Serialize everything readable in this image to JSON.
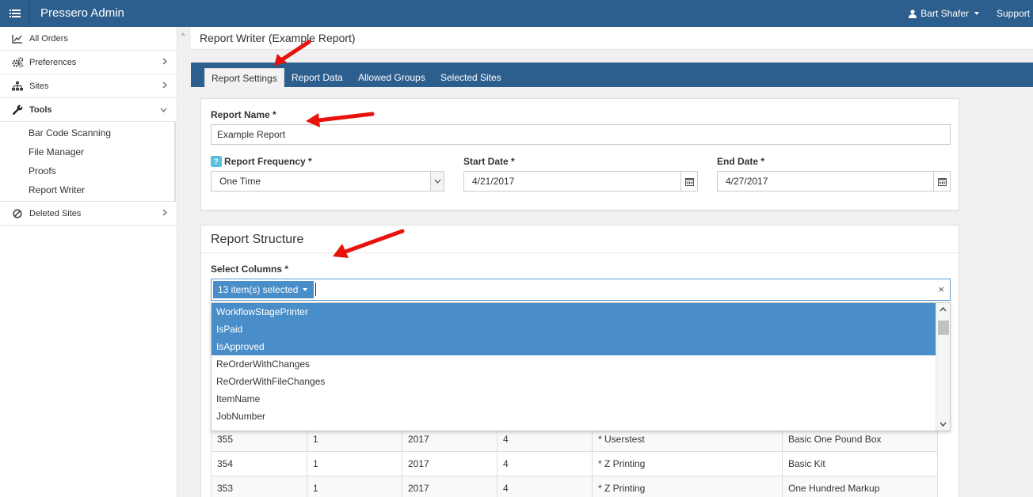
{
  "app": {
    "title": "Pressero Admin",
    "user_name": "Bart Shafer",
    "support_label": "Support"
  },
  "sidebar": {
    "items": [
      {
        "label": "All Orders",
        "icon": "chart-line-icon"
      },
      {
        "label": "Preferences",
        "icon": "cogs-icon"
      },
      {
        "label": "Sites",
        "icon": "sitemap-icon"
      },
      {
        "label": "Tools",
        "icon": "wrench-icon"
      }
    ],
    "tools_submenu": [
      "Bar Code Scanning",
      "File Manager",
      "Proofs",
      "Report Writer"
    ],
    "deleted_sites": {
      "label": "Deleted Sites",
      "icon": "ban-icon"
    }
  },
  "page": {
    "title": "Report Writer (Example Report)"
  },
  "tabs": [
    "Report Settings",
    "Report Data",
    "Allowed Groups",
    "Selected Sites"
  ],
  "settings": {
    "report_name_label": "Report Name *",
    "report_name_value": "Example Report",
    "frequency_label": "Report Frequency *",
    "frequency_value": "One Time",
    "help_badge": "?",
    "start_label": "Start Date *",
    "start_value": "4/21/2017",
    "end_label": "End Date *",
    "end_value": "4/27/2017"
  },
  "structure": {
    "title": "Report Structure",
    "select_columns_label": "Select Columns *",
    "selected_summary": "13 item(s) selected",
    "clear_symbol": "×",
    "options": [
      {
        "label": "WorkflowStagePrinter",
        "selected": true
      },
      {
        "label": "IsPaid",
        "selected": true
      },
      {
        "label": "IsApproved",
        "selected": true
      },
      {
        "label": "ReOrderWithChanges",
        "selected": false
      },
      {
        "label": "ReOrderWithFileChanges",
        "selected": false
      },
      {
        "label": "ItemName",
        "selected": false
      },
      {
        "label": "JobNumber",
        "selected": false
      }
    ]
  },
  "table": {
    "rows": [
      [
        "355",
        "1",
        "2017",
        "4",
        "* Userstest",
        "Basic One Pound Box"
      ],
      [
        "354",
        "1",
        "2017",
        "4",
        "* Z Printing",
        "Basic Kit"
      ],
      [
        "353",
        "1",
        "2017",
        "4",
        "* Z Printing",
        "One Hundred Markup"
      ]
    ]
  },
  "colors": {
    "topbar": "#2d5f8e",
    "accent": "#4a8ec9",
    "arrow": "#e8120c"
  }
}
